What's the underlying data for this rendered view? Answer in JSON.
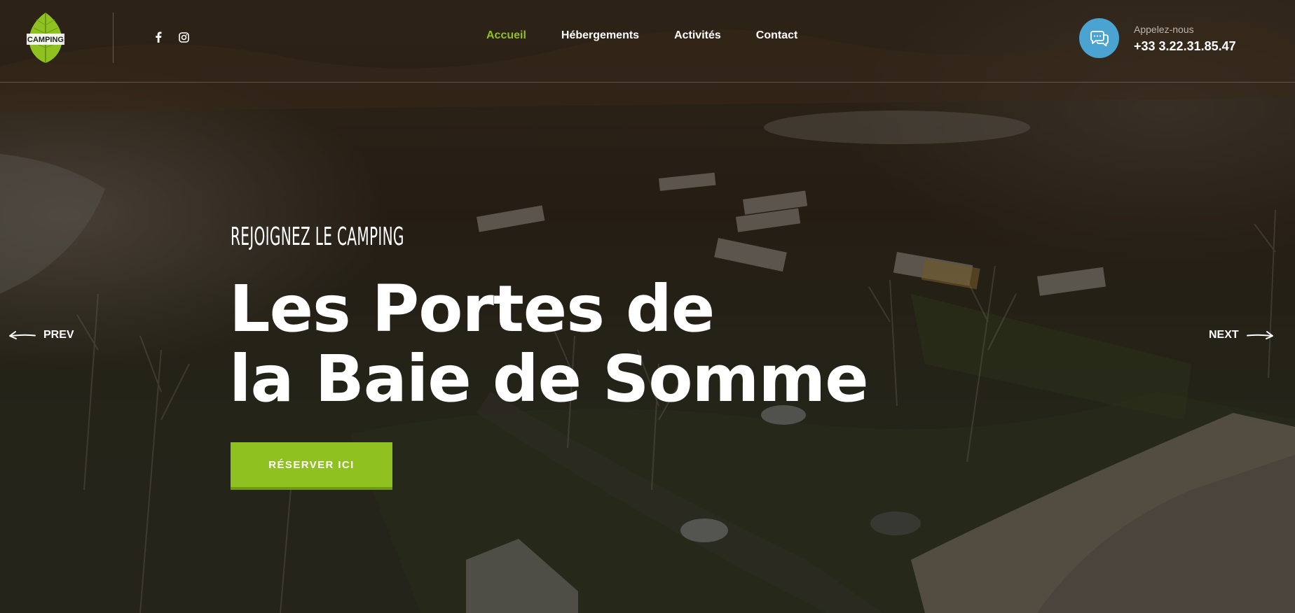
{
  "brand": {
    "logo_text": "CAMPING",
    "logo_color": "#8fc220"
  },
  "social": [
    {
      "icon": "facebook-icon"
    },
    {
      "icon": "instagram-icon"
    }
  ],
  "nav": {
    "items": [
      {
        "label": "Accueil",
        "active": true
      },
      {
        "label": "Hébergements",
        "active": false
      },
      {
        "label": "Activités",
        "active": false
      },
      {
        "label": "Contact",
        "active": false
      }
    ],
    "active_color": "#8fc220"
  },
  "contact": {
    "label": "Appelez-nous",
    "phone": "+33 3.22.31.85.47",
    "icon": "chat-bubbles-icon",
    "icon_bg": "#4aa3d1"
  },
  "hero": {
    "eyebrow": "REJOIGNEZ LE CAMPING",
    "title_line1": "Les Portes de",
    "title_line2": "la Baie de Somme",
    "cta_label": "RÉSERVER ICI",
    "cta_color": "#8fc220"
  },
  "slider": {
    "prev_label": "PREV",
    "next_label": "NEXT"
  }
}
